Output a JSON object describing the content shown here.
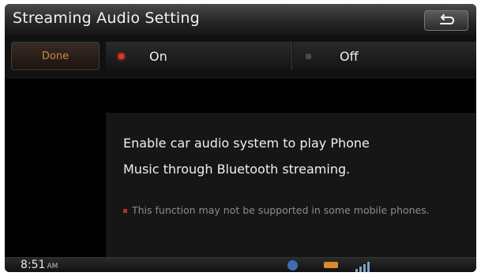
{
  "header": {
    "title": "Streaming Audio Setting",
    "back_icon": "back-arrow-icon"
  },
  "options": {
    "done_label": "Done",
    "on_label": "On",
    "off_label": "Off",
    "selected": "On",
    "colors": {
      "selected_indicator": "#e53030",
      "unselected_indicator": "#4a4a4a",
      "done_text": "#c98a4a"
    }
  },
  "panel": {
    "line1": "Enable car audio system to play Phone",
    "line2": "Music through Bluetooth streaming.",
    "note": "This function may not be supported in some mobile phones."
  },
  "statusbar": {
    "time": "8:51",
    "ampm": "AM",
    "icons": [
      "bluetooth-icon",
      "battery-icon",
      "signal-icon"
    ]
  }
}
